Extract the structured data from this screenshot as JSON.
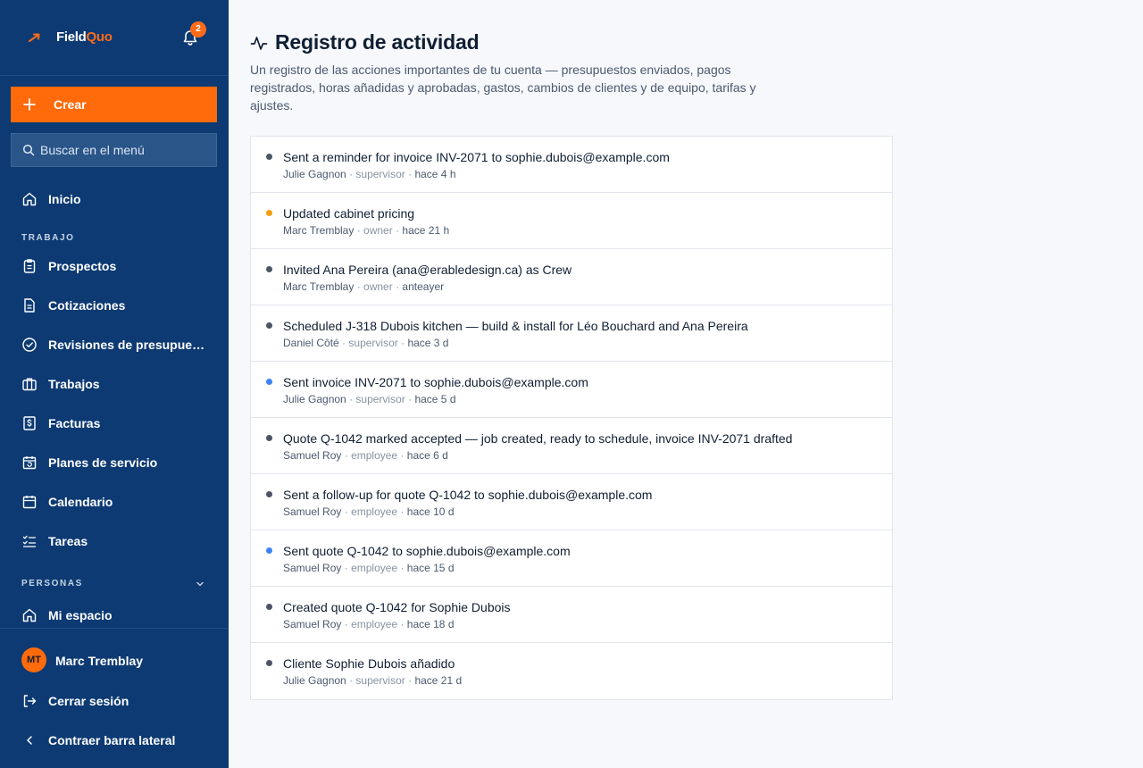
{
  "app": {
    "brand_prefix": "Field",
    "brand_accent": "Quo",
    "notifications_count": "2",
    "accent_color": "#ff6a0a",
    "sidebar_color": "#0d3a73"
  },
  "sidebar": {
    "create_label": "Crear",
    "search_placeholder": "Buscar en el menú",
    "home_label": "Inicio",
    "section_work": "TRABAJO",
    "work_items": [
      {
        "label": "Prospectos",
        "icon": "clipboard-icon"
      },
      {
        "label": "Cotizaciones",
        "icon": "document-icon"
      },
      {
        "label": "Revisiones de presupuestos",
        "icon": "check-circle-icon"
      },
      {
        "label": "Trabajos",
        "icon": "briefcase-icon"
      },
      {
        "label": "Facturas",
        "icon": "invoice-dollar-icon"
      },
      {
        "label": "Planes de servicio",
        "icon": "calendar-repeat-icon"
      },
      {
        "label": "Calendario",
        "icon": "calendar-icon"
      },
      {
        "label": "Tareas",
        "icon": "checklist-icon"
      }
    ],
    "section_people": "PERSONAS",
    "people_items": [
      {
        "label": "Mi espacio",
        "icon": "home-icon"
      }
    ],
    "user": {
      "initials": "MT",
      "name": "Marc Tremblay"
    },
    "logout_label": "Cerrar sesión",
    "collapse_label": "Contraer barra lateral"
  },
  "main": {
    "title": "Registro de actividad",
    "description": "Un registro de las acciones importantes de tu cuenta — presupuestos enviados, pagos registrados, horas añadidas y aprobadas, gastos, cambios de clientes y de equipo, tarifas y ajustes.",
    "activities": [
      {
        "text": "Sent a reminder for invoice INV-2071 to sophie.dubois@example.com",
        "actor": "Julie Gagnon",
        "role": "supervisor",
        "time": "hace 4 h",
        "dot_color": "#4b5563"
      },
      {
        "text": "Updated cabinet pricing",
        "actor": "Marc Tremblay",
        "role": "owner",
        "time": "hace 21 h",
        "dot_color": "#f59e0b"
      },
      {
        "text": "Invited Ana Pereira (ana@erabledesign.ca) as Crew",
        "actor": "Marc Tremblay",
        "role": "owner",
        "time": "anteayer",
        "dot_color": "#4b5563"
      },
      {
        "text": "Scheduled J-318 Dubois kitchen — build & install for Léo Bouchard and Ana Pereira",
        "actor": "Daniel Côté",
        "role": "supervisor",
        "time": "hace 3 d",
        "dot_color": "#4b5563"
      },
      {
        "text": "Sent invoice INV-2071 to sophie.dubois@example.com",
        "actor": "Julie Gagnon",
        "role": "supervisor",
        "time": "hace 5 d",
        "dot_color": "#3b82f6"
      },
      {
        "text": "Quote Q-1042 marked accepted — job created, ready to schedule, invoice INV-2071 drafted",
        "actor": "Samuel Roy",
        "role": "employee",
        "time": "hace 6 d",
        "dot_color": "#4b5563"
      },
      {
        "text": "Sent a follow-up for quote Q-1042 to sophie.dubois@example.com",
        "actor": "Samuel Roy",
        "role": "employee",
        "time": "hace 10 d",
        "dot_color": "#4b5563"
      },
      {
        "text": "Sent quote Q-1042 to sophie.dubois@example.com",
        "actor": "Samuel Roy",
        "role": "employee",
        "time": "hace 15 d",
        "dot_color": "#3b82f6"
      },
      {
        "text": "Created quote Q-1042 for Sophie Dubois",
        "actor": "Samuel Roy",
        "role": "employee",
        "time": "hace 18 d",
        "dot_color": "#4b5563"
      },
      {
        "text": "Cliente Sophie Dubois añadido",
        "actor": "Julie Gagnon",
        "role": "supervisor",
        "time": "hace 21 d",
        "dot_color": "#4b5563"
      }
    ]
  }
}
